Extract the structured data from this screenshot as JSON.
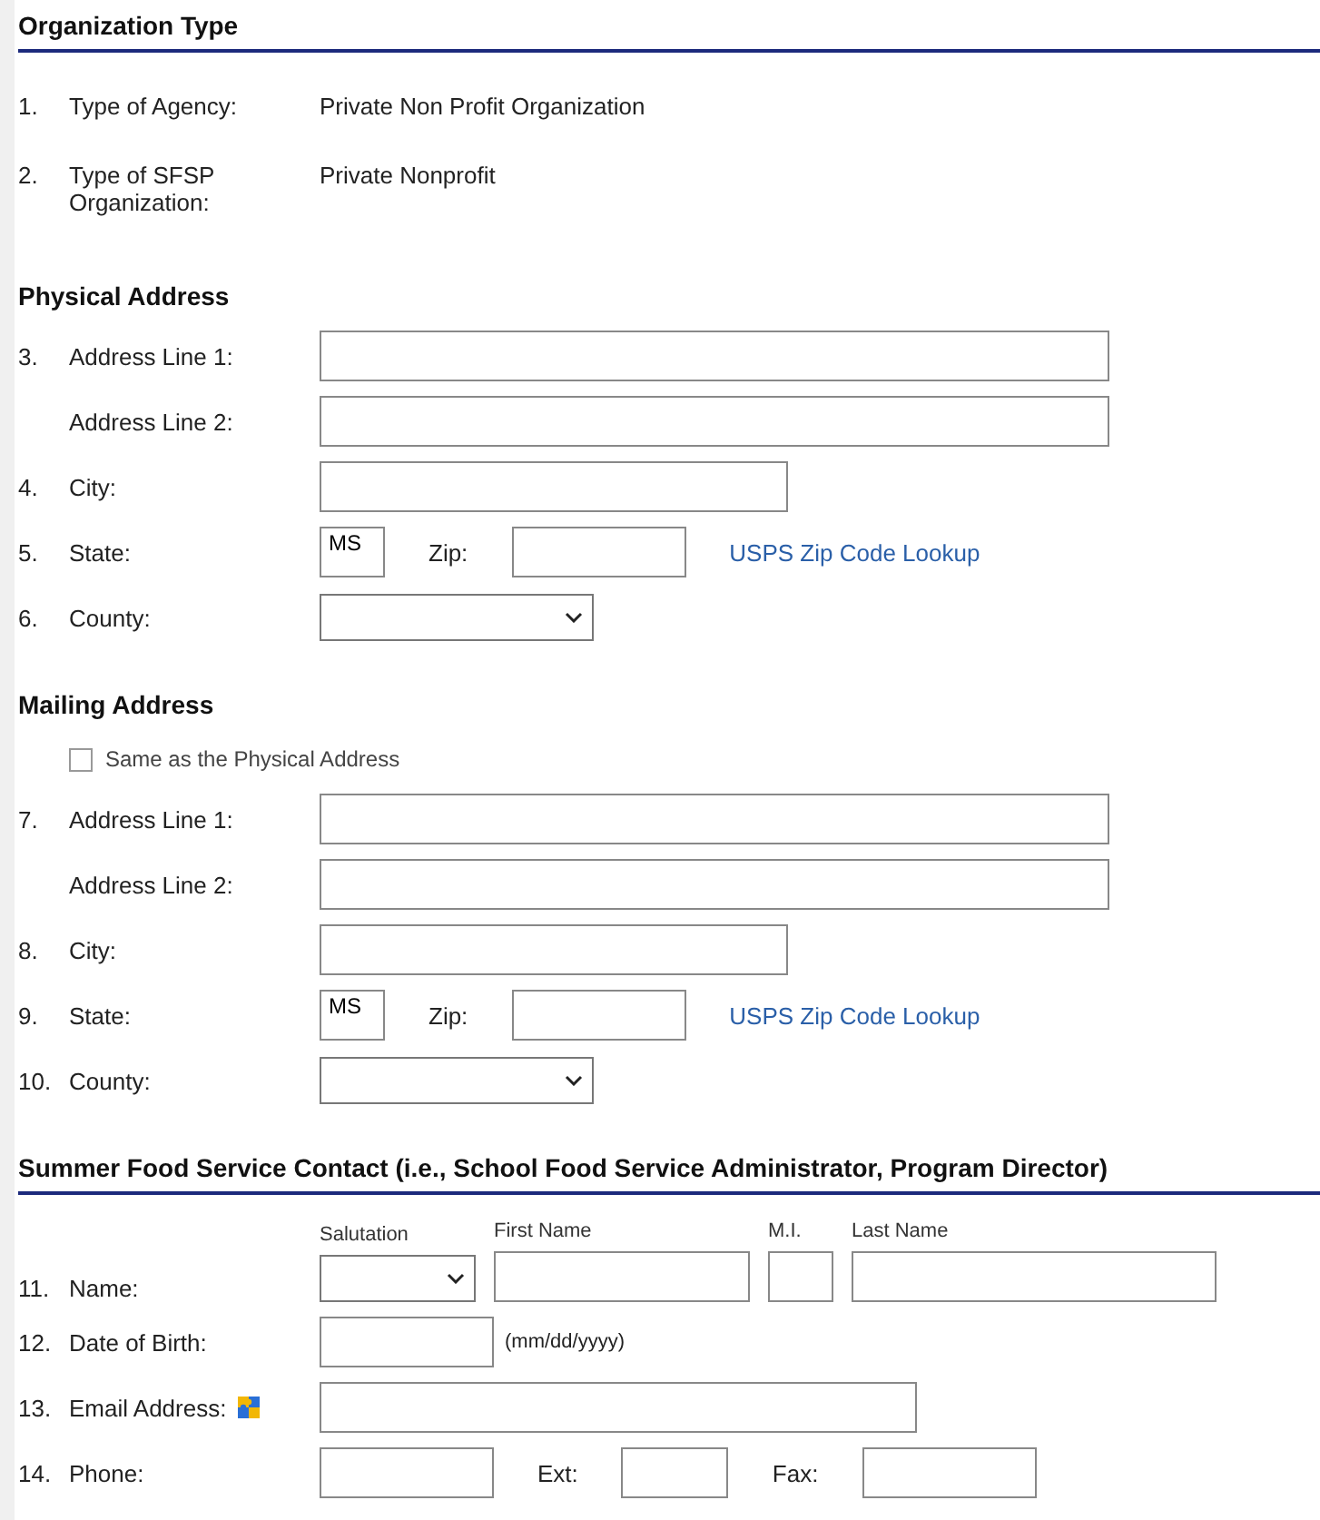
{
  "sections": [
    {
      "title": "Organization Type",
      "underlined": true,
      "rows": [
        {
          "kind": "fields",
          "number": "1.",
          "label": "Type of Agency:",
          "controls": [
            {
              "kind": "text",
              "text": "Private Non Profit Organization"
            }
          ]
        },
        {
          "kind": "fields",
          "number": "2.",
          "label": "Type of SFSP Organization:",
          "controls": [
            {
              "kind": "text",
              "text": "Private Nonprofit"
            }
          ]
        }
      ]
    },
    {
      "title": "Physical Address",
      "underlined": false,
      "rows": [
        {
          "kind": "fields",
          "number": "3.",
          "label": "Address Line 1:",
          "controls": [
            {
              "kind": "long"
            }
          ]
        },
        {
          "kind": "fields",
          "label": "Address Line 2:",
          "controls": [
            {
              "kind": "long"
            }
          ]
        },
        {
          "kind": "fields",
          "number": "4.",
          "label": "City:",
          "controls": [
            {
              "kind": "medium"
            }
          ]
        },
        {
          "kind": "fields",
          "number": "5.",
          "label": "State:",
          "controls": [
            {
              "kind": "tiny",
              "value": "MS"
            },
            {
              "kind": "label",
              "text": "Zip:"
            },
            {
              "kind": "short"
            },
            {
              "kind": "link",
              "text": "USPS Zip Code Lookup"
            }
          ]
        },
        {
          "kind": "fields",
          "number": "6.",
          "label": "County:",
          "controls": [
            {
              "kind": "dropdown"
            }
          ]
        }
      ]
    },
    {
      "title": "Mailing Address",
      "underlined": false,
      "rows": [
        {
          "kind": "checkbox",
          "label": "Same as the Physical Address",
          "checked": false
        },
        {
          "kind": "fields",
          "number": "7.",
          "label": "Address Line 1:",
          "controls": [
            {
              "kind": "long"
            }
          ]
        },
        {
          "kind": "fields",
          "label": "Address Line 2:",
          "controls": [
            {
              "kind": "long"
            }
          ]
        },
        {
          "kind": "fields",
          "number": "8.",
          "label": "City:",
          "controls": [
            {
              "kind": "medium"
            }
          ]
        },
        {
          "kind": "fields",
          "number": "9.",
          "label": "State:",
          "controls": [
            {
              "kind": "tiny",
              "value": "MS"
            },
            {
              "kind": "label",
              "text": "Zip:"
            },
            {
              "kind": "short"
            },
            {
              "kind": "link",
              "text": "USPS Zip Code Lookup"
            }
          ]
        },
        {
          "kind": "fields",
          "number": "10.",
          "label": "County:",
          "controls": [
            {
              "kind": "dropdown"
            }
          ]
        }
      ]
    },
    {
      "title": "Summer Food Service Contact (i.e., School Food Service Administrator, Program Director)",
      "underlined": true,
      "rows": [
        {
          "kind": "fields",
          "number": "11.",
          "label": "Name:",
          "controls": [
            {
              "kind": "minidropdown",
              "heading": "Salutation"
            },
            {
              "kind": "narrow",
              "heading": "First Name"
            },
            {
              "kind": "tiny",
              "heading": "M.I."
            },
            {
              "kind": "half",
              "heading": "Last Name"
            }
          ]
        },
        {
          "kind": "fields",
          "number": "12.",
          "label": "Date of Birth:",
          "controls": [
            {
              "kind": "short"
            },
            {
              "kind": "hint",
              "text": "(mm/dd/yyyy)"
            }
          ]
        },
        {
          "kind": "fields",
          "number": "13.",
          "label": "Email Address:",
          "has_icon": true,
          "controls": [
            {
              "kind": "wide"
            }
          ]
        },
        {
          "kind": "fields",
          "number": "14.",
          "label": "Phone:",
          "controls": [
            {
              "kind": "short"
            },
            {
              "kind": "label",
              "text": "Ext:"
            },
            {
              "kind": "small"
            },
            {
              "kind": "label",
              "text": "Fax:"
            },
            {
              "kind": "short"
            }
          ]
        }
      ]
    }
  ]
}
